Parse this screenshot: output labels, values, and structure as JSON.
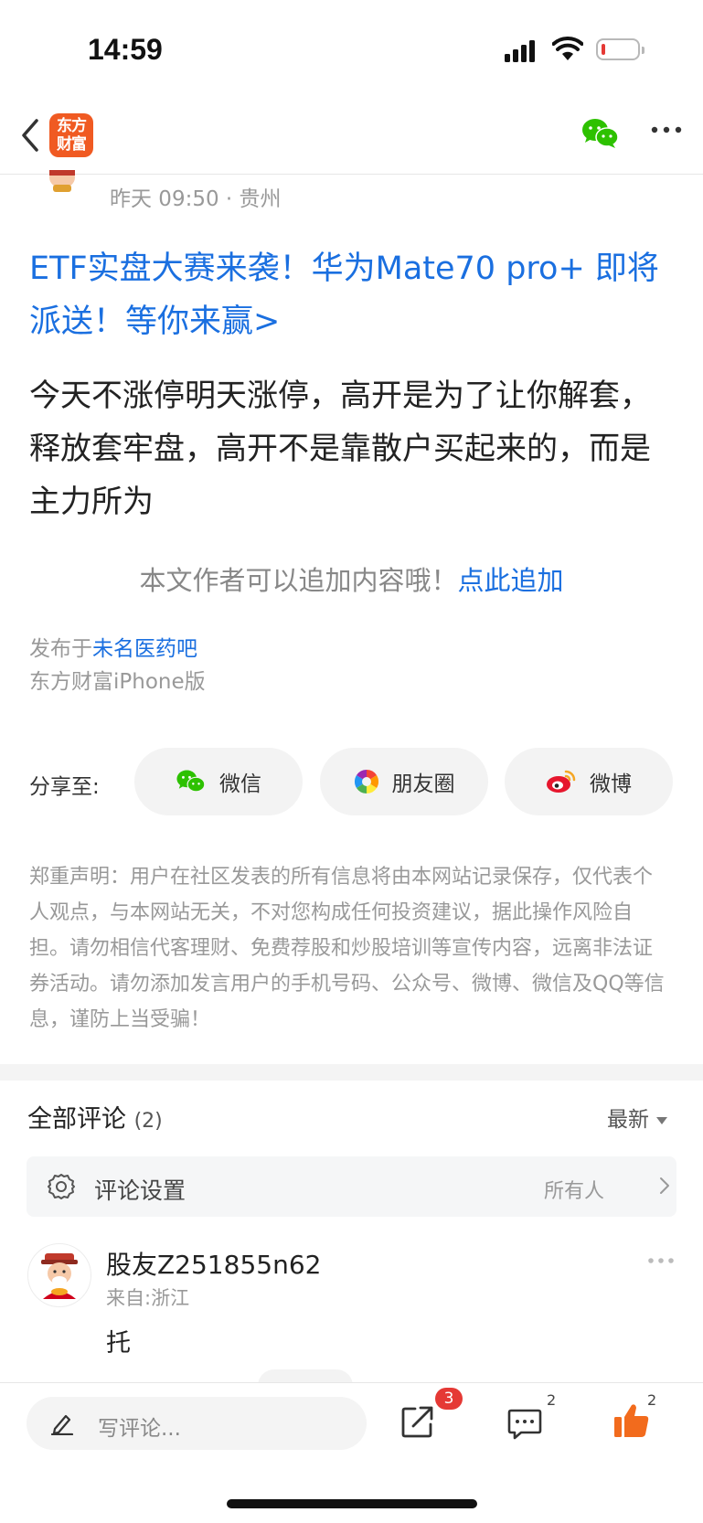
{
  "status_bar": {
    "time": "14:59"
  },
  "nav": {
    "logo_text_line1": "东方",
    "logo_text_line2": "财富"
  },
  "post": {
    "time_location": "昨天 09:50 · 贵州",
    "ad_link": "ETF实盘大赛来袭！华为Mate70 pro+ 即将派送！等你来赢>",
    "body": "今天不涨停明天涨停，高开是为了让你解套，释放套牢盘，高开不是靠散户买起来的，而是主力所为",
    "append_prompt": "本文作者可以追加内容哦！",
    "append_link": "点此追加",
    "published_prefix": "发布于",
    "published_forum": "未名医药吧",
    "client": "东方财富iPhone版"
  },
  "share": {
    "label": "分享至:",
    "targets": [
      {
        "label": "微信",
        "icon": "wechat-icon"
      },
      {
        "label": "朋友圈",
        "icon": "moments-icon"
      },
      {
        "label": "微博",
        "icon": "weibo-icon"
      }
    ]
  },
  "disclaimer": "郑重声明：用户在社区发表的所有信息将由本网站记录保存，仅代表个人观点，与本网站无关，不对您构成任何投资建议，据此操作风险自担。请勿相信代客理财、免费荐股和炒股培训等宣传内容，远离非法证券活动。请勿添加发言用户的手机号码、公众号、微博、微信及QQ等信息，谨防上当受骗！",
  "comments": {
    "title": "全部评论",
    "count": "(2)",
    "sort": "最新",
    "settings_label": "评论设置",
    "settings_value": "所有人",
    "items": [
      {
        "user": "股友Z251855n62",
        "location": "来自:浙江",
        "text": "托"
      }
    ]
  },
  "bottom_bar": {
    "write_placeholder": "写评论...",
    "share_badge": "3",
    "comment_count": "2",
    "like_count": "2"
  },
  "colors": {
    "link_blue": "#1a6fe0",
    "brand_orange": "#f05a22",
    "like_orange": "#f26b1d",
    "badge_red": "#e53935"
  }
}
